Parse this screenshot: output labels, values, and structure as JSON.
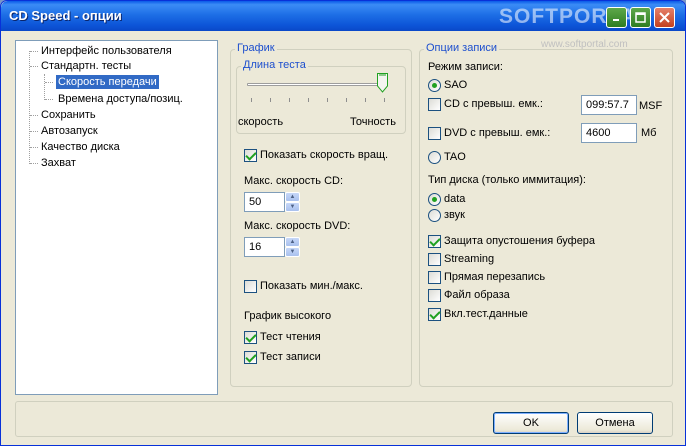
{
  "window": {
    "title": "CD Speed - опции"
  },
  "watermark": {
    "brand": "SOFTPORTAL",
    "url": "www.softportal.com"
  },
  "tree": {
    "items": [
      {
        "label": "Интерфейс пользователя"
      },
      {
        "label": "Стандартн. тесты"
      },
      {
        "label": "Скорость передачи"
      },
      {
        "label": "Времена доступа/позиц."
      },
      {
        "label": "Сохранить"
      },
      {
        "label": "Автозапуск"
      },
      {
        "label": "Качество диска"
      },
      {
        "label": "Захват"
      }
    ],
    "selected": "Скорость передачи"
  },
  "graph": {
    "legend": "График",
    "test_length": {
      "legend": "Длина теста",
      "left_label": "скорость",
      "right_label": "Точность",
      "value_fraction": 1.0
    },
    "show_rotation": {
      "label": "Показать скорость вращ.",
      "checked": true
    },
    "max_cd": {
      "label": "Макс. скорость CD:",
      "value": "50"
    },
    "max_dvd": {
      "label": "Макс. скорость DVD:",
      "value": "16"
    },
    "show_minmax": {
      "label": "Показать мин./макс.",
      "checked": false
    },
    "high_graph": {
      "label": "График высокого"
    },
    "test_read": {
      "label": "Тест чтения",
      "checked": true
    },
    "test_write": {
      "label": "Тест записи",
      "checked": true
    }
  },
  "write_options": {
    "legend": "Опции записи",
    "write_mode": {
      "label": "Режим записи:"
    },
    "sao": {
      "label": "SAO",
      "selected": true
    },
    "cd_over": {
      "label": "CD с превыш. емк.:",
      "checked": false,
      "value": "099:57.7",
      "unit": "MSF"
    },
    "dvd_over": {
      "label": "DVD с превыш. емк.:",
      "checked": false,
      "value": "4600",
      "unit": "Мб"
    },
    "tao": {
      "label": "TAO",
      "selected": false
    },
    "disc_type": {
      "label": "Тип диска (только иммитация):"
    },
    "data": {
      "label": "data",
      "selected": true
    },
    "sound": {
      "label": "звук",
      "selected": false
    },
    "buffer_protect": {
      "label": "Защита опустошения буфера",
      "checked": true
    },
    "streaming": {
      "label": "Streaming",
      "checked": false
    },
    "direct_overwrite": {
      "label": "Прямая перезапись",
      "checked": false
    },
    "image_file": {
      "label": "Файл образа",
      "checked": false
    },
    "test_data": {
      "label": "Вкл.тест.данные",
      "checked": true
    }
  },
  "buttons": {
    "ok": "OK",
    "cancel": "Отмена"
  }
}
